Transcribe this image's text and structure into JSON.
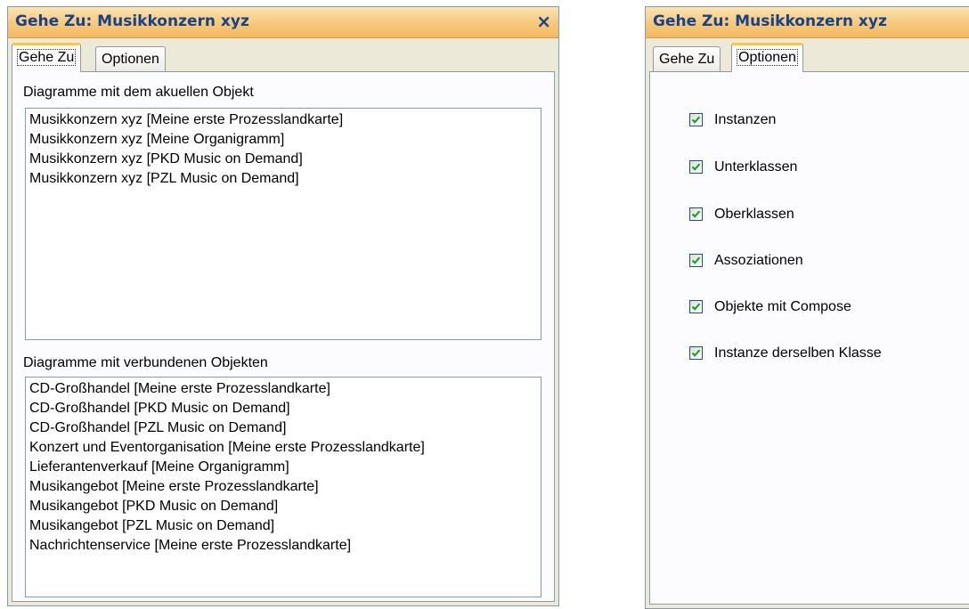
{
  "left_panel": {
    "title": "Gehe Zu: Musikkonzern xyz",
    "close_glyph": "×",
    "tabs": [
      {
        "label": "Gehe Zu",
        "active": true
      },
      {
        "label": "Optionen",
        "active": false
      }
    ],
    "current_label": "Diagramme mit dem akuellen Objekt",
    "current_items": [
      "Musikkonzern xyz [Meine erste Prozesslandkarte]",
      "Musikkonzern xyz [Meine Organigramm]",
      "Musikkonzern xyz [PKD Music on Demand]",
      "Musikkonzern xyz [PZL Music on Demand]"
    ],
    "related_label": "Diagramme mit verbundenen Objekten",
    "related_items": [
      "CD-Großhandel [Meine erste Prozesslandkarte]",
      "CD-Großhandel [PKD Music on Demand]",
      "CD-Großhandel [PZL Music on Demand]",
      "Konzert und Eventorganisation [Meine erste Prozesslandkarte]",
      "Lieferantenverkauf [Meine Organigramm]",
      "Musikangebot [Meine erste Prozesslandkarte]",
      "Musikangebot [PKD Music on Demand]",
      "Musikangebot [PZL Music on Demand]",
      "Nachrichtenservice [Meine erste Prozesslandkarte]"
    ]
  },
  "right_panel": {
    "title": "Gehe Zu: Musikkonzern xyz",
    "tabs": [
      {
        "label": "Gehe Zu",
        "active": false
      },
      {
        "label": "Optionen",
        "active": true
      }
    ],
    "options": [
      {
        "label": "Instanzen",
        "checked": true
      },
      {
        "label": "Unterklassen",
        "checked": true
      },
      {
        "label": "Oberklassen",
        "checked": true
      },
      {
        "label": "Assoziationen",
        "checked": true
      },
      {
        "label": "Objekte mit Compose",
        "checked": true
      },
      {
        "label": "Instanze derselben Klasse",
        "checked": true
      }
    ]
  },
  "colors": {
    "titlebar": "#f7c87a",
    "title_text": "#15428b",
    "check_mark": "#21a121",
    "panel_bg": "#ece9d8",
    "tab_highlight": "#ffc83c"
  }
}
